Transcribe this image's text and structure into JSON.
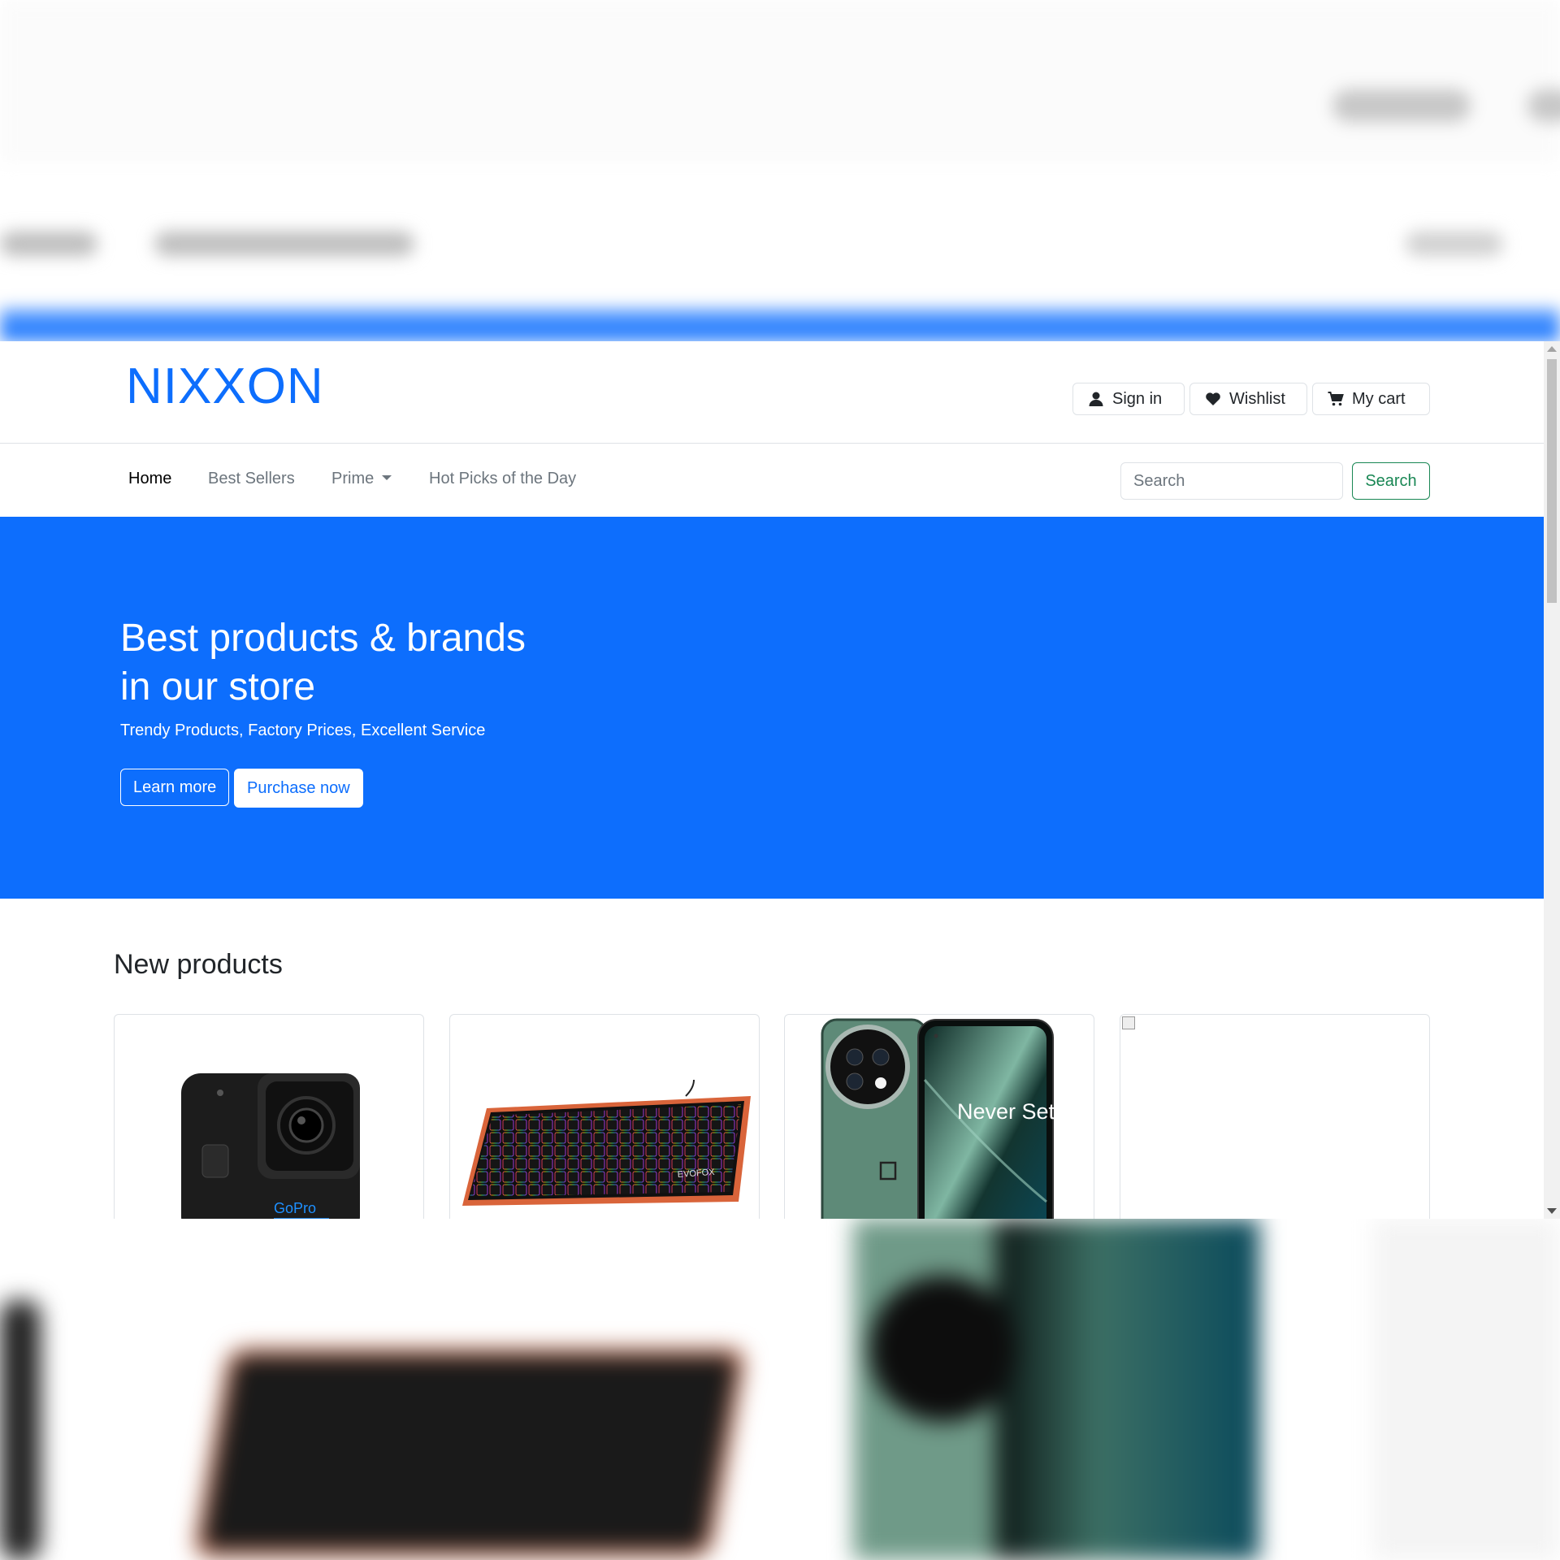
{
  "brand": {
    "logo_text": "NIXXON",
    "primary_color": "#0d6efd",
    "success_color": "#198754"
  },
  "header": {
    "actions": [
      {
        "label": "Sign in",
        "icon": "user-icon"
      },
      {
        "label": "Wishlist",
        "icon": "heart-icon"
      },
      {
        "label": "My cart",
        "icon": "cart-icon"
      }
    ]
  },
  "nav": {
    "items": [
      {
        "label": "Home",
        "active": true
      },
      {
        "label": "Best Sellers",
        "active": false
      },
      {
        "label": "Prime",
        "active": false,
        "dropdown": true
      },
      {
        "label": "Hot Picks of the Day",
        "active": false
      }
    ],
    "search": {
      "placeholder": "Search",
      "button_label": "Search"
    }
  },
  "hero": {
    "title": "Best products & brands in our store",
    "subtitle": "Trendy Products, Factory Prices, Excellent Service",
    "primary_button": "Learn more",
    "secondary_button": "Purchase now"
  },
  "new_products": {
    "title": "New products",
    "items": [
      {
        "image": "action-camera",
        "image_text": "GoPro"
      },
      {
        "image": "rgb-keyboard",
        "image_text": "EVOFOX"
      },
      {
        "image": "smartphone",
        "image_text": "Never Settle"
      },
      {
        "image": "broken-image"
      }
    ]
  }
}
